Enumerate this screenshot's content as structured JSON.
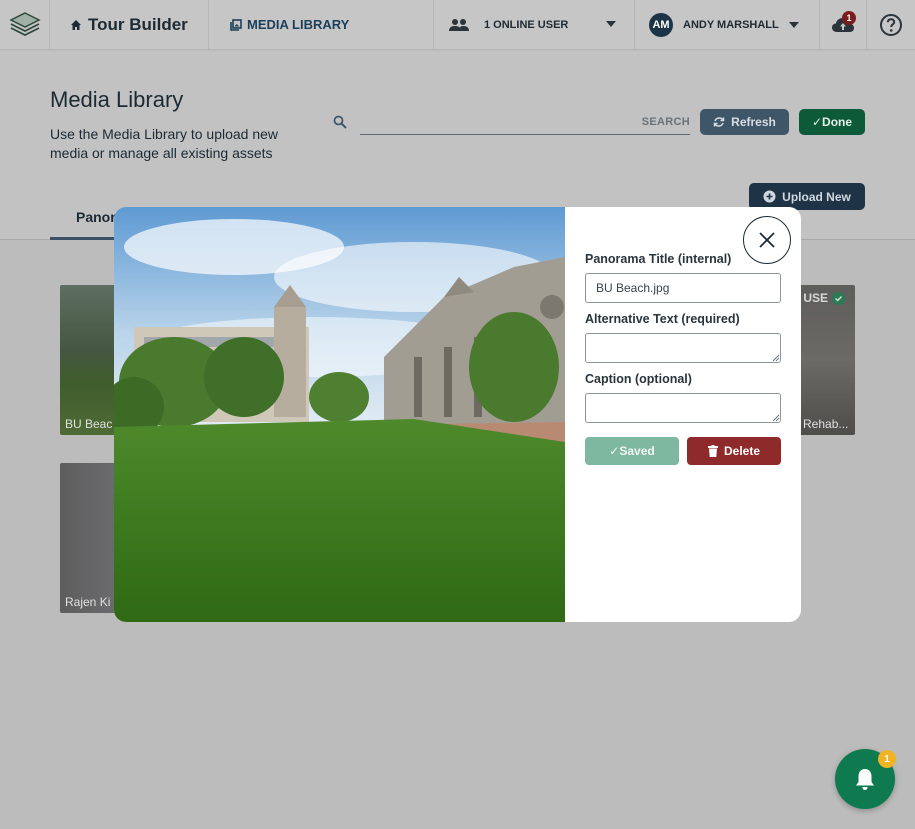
{
  "topbar": {
    "brand_label": "Tour Builder",
    "media_label": "MEDIA LIBRARY",
    "online_users_label": "1 ONLINE USER",
    "account": {
      "initials": "AM",
      "name": "ANDY MARSHALL"
    },
    "cloud_badge": "1",
    "icons": {
      "logo": "layers-logo-icon",
      "home": "home-icon",
      "media": "photo-library-icon",
      "users": "group-icon",
      "cloud": "cloud-upload-icon",
      "help": "help-circle-icon"
    }
  },
  "header": {
    "title": "Media Library",
    "description": "Use the Media Library to upload new media or manage all existing assets",
    "search": {
      "placeholder": "",
      "label": "SEARCH"
    },
    "refresh_label": "Refresh",
    "done_label": "✓Done",
    "upload_label": "Upload New",
    "tab_label": "Panor"
  },
  "grid": {
    "cards": [
      {
        "label": "BU Beac"
      },
      {
        "label": "Rehab...",
        "status": "USE"
      },
      {
        "label": "Rajen Ki"
      }
    ]
  },
  "modal": {
    "image_name": "BU Beach panorama",
    "fields": {
      "title_label": "Panorama Title (internal)",
      "title_value": "BU Beach.jpg",
      "alt_label": "Alternative Text (required)",
      "alt_value": "",
      "caption_label": "Caption (optional)",
      "caption_value": ""
    },
    "saved_label": "✓Saved",
    "delete_label": "Delete"
  },
  "notification": {
    "count": "1"
  },
  "colors": {
    "primary_dark": "#1e3346",
    "success_green": "#0c5a37",
    "danger_red": "#8f2a2a",
    "saved_green": "#7eb8a0",
    "fab_green": "#0f7a4f",
    "badge_yellow": "#f0b323"
  }
}
